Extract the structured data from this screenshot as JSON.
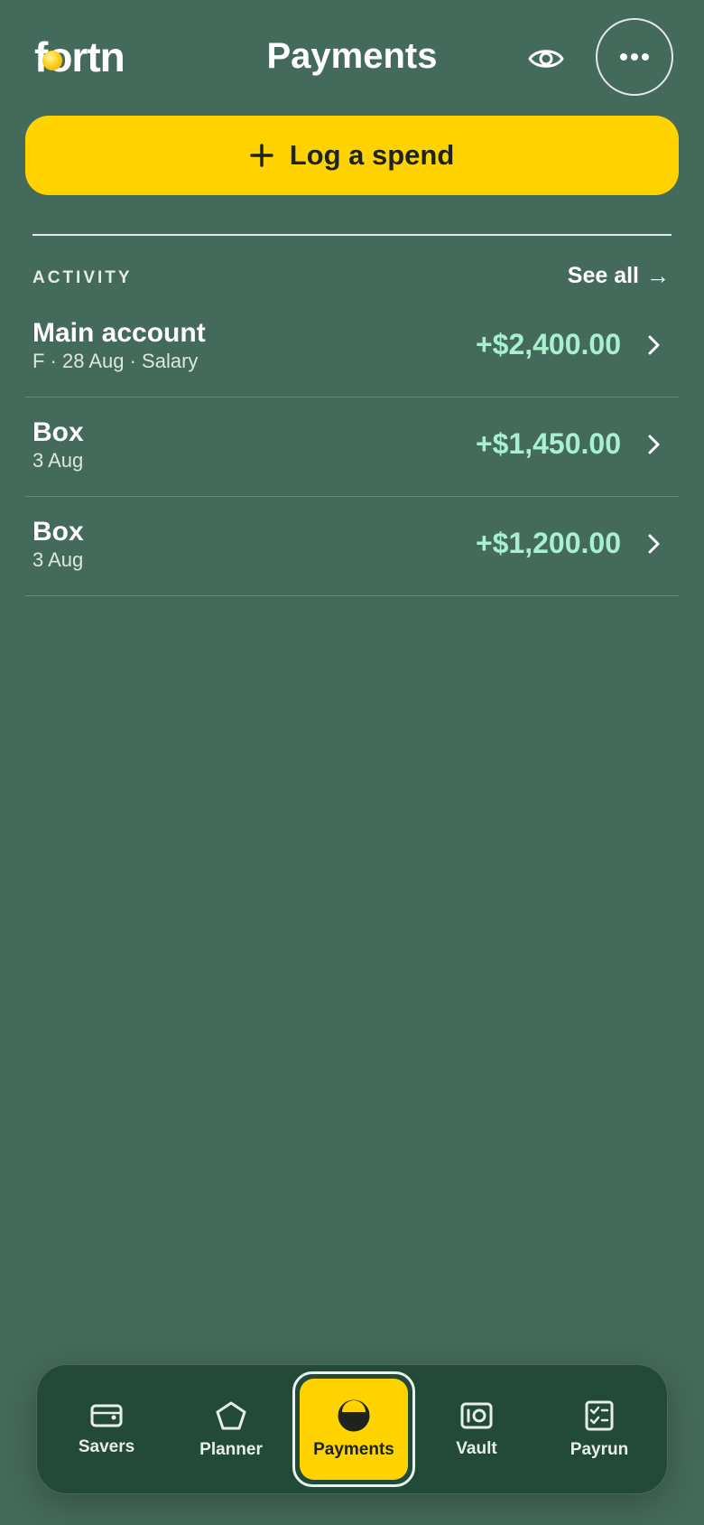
{
  "header": {
    "logo_text": "fortn",
    "title": "Payments",
    "eye_icon": "eye-icon",
    "more_icon": "more-horizontal-icon"
  },
  "actions": {
    "log_spend_label": "Log a spend",
    "log_spend_icon": "plus-icon"
  },
  "activity": {
    "label": "ACTIVITY",
    "see_all_label": "See all",
    "see_all_arrow": "→",
    "rows": [
      {
        "title": "Main account",
        "subtitle": "F · 28 Aug · Salary",
        "amount": "+$2,400.00"
      },
      {
        "title": "Box",
        "subtitle": "3 Aug",
        "amount": "+$1,450.00"
      },
      {
        "title": "Box",
        "subtitle": "3 Aug",
        "amount": "+$1,200.00"
      }
    ]
  },
  "nav": {
    "items": [
      {
        "label": "Savers",
        "icon": "wallet-icon"
      },
      {
        "label": "Planner",
        "icon": "pentagon-icon"
      },
      {
        "label": "Payments",
        "icon": "half-circle-icon",
        "active": true
      },
      {
        "label": "Vault",
        "icon": "vault-icon"
      },
      {
        "label": "Payrun",
        "icon": "checklist-icon"
      }
    ]
  },
  "colors": {
    "background": "#446a5b",
    "accent": "#ffd300",
    "amount_positive": "#a8f0cf",
    "nav_background": "#234939"
  }
}
